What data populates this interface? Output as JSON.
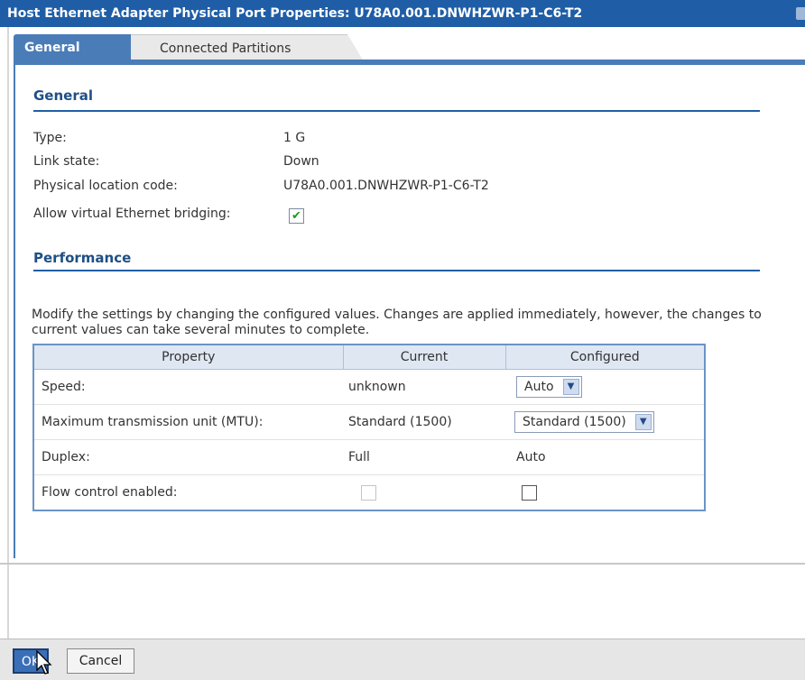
{
  "window": {
    "title": "Host Ethernet Adapter Physical Port Properties: U78A0.001.DNWHZWR-P1-C6-T2"
  },
  "tabs": [
    {
      "label": "General",
      "active": true
    },
    {
      "label": "Connected Partitions",
      "active": false
    }
  ],
  "general": {
    "section_title": "General",
    "fields": [
      {
        "label": "Type:",
        "value": "1 G"
      },
      {
        "label": "Link state:",
        "value": "Down"
      },
      {
        "label": "Physical location code:",
        "value": "U78A0.001.DNWHZWR-P1-C6-T2"
      }
    ],
    "bridging_label": "Allow virtual Ethernet bridging:",
    "bridging_checked": true
  },
  "performance": {
    "section_title": "Performance",
    "description": "Modify the settings by changing the configured values. Changes are applied immediately, however, the changes to current values can take several minutes to complete.",
    "columns": [
      "Property",
      "Current",
      "Configured"
    ],
    "rows": [
      {
        "property": "Speed:",
        "current": "unknown",
        "configured": "Auto",
        "configured_type": "select"
      },
      {
        "property": "Maximum transmission unit (MTU):",
        "current": "Standard (1500)",
        "configured": "Standard (1500)",
        "configured_type": "select"
      },
      {
        "property": "Duplex:",
        "current": "Full",
        "configured": "Auto",
        "configured_type": "text"
      },
      {
        "property": "Flow control enabled:",
        "current_checked": false,
        "configured_checked": false,
        "configured_type": "checkbox"
      }
    ]
  },
  "buttons": {
    "ok": "OK",
    "cancel": "Cancel"
  },
  "colors": {
    "title_bar": "#1f5ea6",
    "tab_active": "#4a7cb8",
    "section_text": "#1f4f85"
  }
}
